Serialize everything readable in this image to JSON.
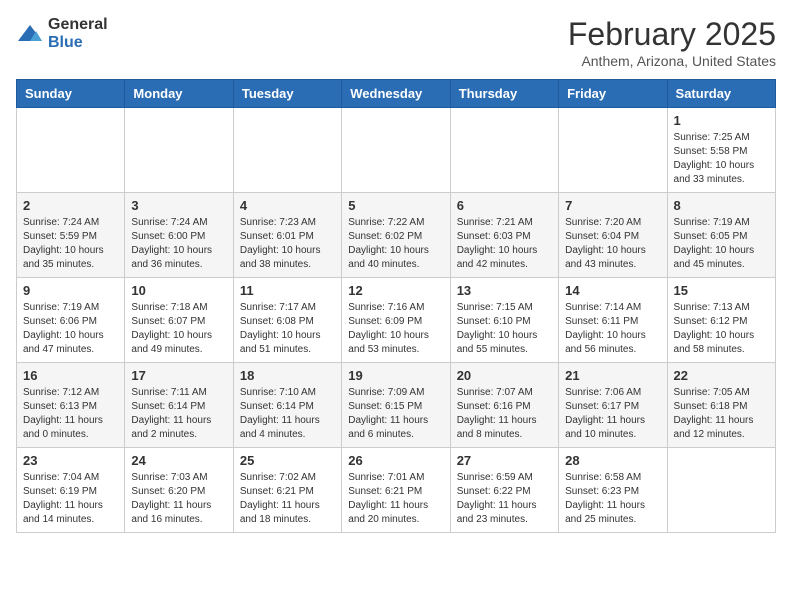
{
  "header": {
    "logo_general": "General",
    "logo_blue": "Blue",
    "month": "February 2025",
    "location": "Anthem, Arizona, United States"
  },
  "weekdays": [
    "Sunday",
    "Monday",
    "Tuesday",
    "Wednesday",
    "Thursday",
    "Friday",
    "Saturday"
  ],
  "weeks": [
    [
      {
        "day": "",
        "info": ""
      },
      {
        "day": "",
        "info": ""
      },
      {
        "day": "",
        "info": ""
      },
      {
        "day": "",
        "info": ""
      },
      {
        "day": "",
        "info": ""
      },
      {
        "day": "",
        "info": ""
      },
      {
        "day": "1",
        "info": "Sunrise: 7:25 AM\nSunset: 5:58 PM\nDaylight: 10 hours\nand 33 minutes."
      }
    ],
    [
      {
        "day": "2",
        "info": "Sunrise: 7:24 AM\nSunset: 5:59 PM\nDaylight: 10 hours\nand 35 minutes."
      },
      {
        "day": "3",
        "info": "Sunrise: 7:24 AM\nSunset: 6:00 PM\nDaylight: 10 hours\nand 36 minutes."
      },
      {
        "day": "4",
        "info": "Sunrise: 7:23 AM\nSunset: 6:01 PM\nDaylight: 10 hours\nand 38 minutes."
      },
      {
        "day": "5",
        "info": "Sunrise: 7:22 AM\nSunset: 6:02 PM\nDaylight: 10 hours\nand 40 minutes."
      },
      {
        "day": "6",
        "info": "Sunrise: 7:21 AM\nSunset: 6:03 PM\nDaylight: 10 hours\nand 42 minutes."
      },
      {
        "day": "7",
        "info": "Sunrise: 7:20 AM\nSunset: 6:04 PM\nDaylight: 10 hours\nand 43 minutes."
      },
      {
        "day": "8",
        "info": "Sunrise: 7:19 AM\nSunset: 6:05 PM\nDaylight: 10 hours\nand 45 minutes."
      }
    ],
    [
      {
        "day": "9",
        "info": "Sunrise: 7:19 AM\nSunset: 6:06 PM\nDaylight: 10 hours\nand 47 minutes."
      },
      {
        "day": "10",
        "info": "Sunrise: 7:18 AM\nSunset: 6:07 PM\nDaylight: 10 hours\nand 49 minutes."
      },
      {
        "day": "11",
        "info": "Sunrise: 7:17 AM\nSunset: 6:08 PM\nDaylight: 10 hours\nand 51 minutes."
      },
      {
        "day": "12",
        "info": "Sunrise: 7:16 AM\nSunset: 6:09 PM\nDaylight: 10 hours\nand 53 minutes."
      },
      {
        "day": "13",
        "info": "Sunrise: 7:15 AM\nSunset: 6:10 PM\nDaylight: 10 hours\nand 55 minutes."
      },
      {
        "day": "14",
        "info": "Sunrise: 7:14 AM\nSunset: 6:11 PM\nDaylight: 10 hours\nand 56 minutes."
      },
      {
        "day": "15",
        "info": "Sunrise: 7:13 AM\nSunset: 6:12 PM\nDaylight: 10 hours\nand 58 minutes."
      }
    ],
    [
      {
        "day": "16",
        "info": "Sunrise: 7:12 AM\nSunset: 6:13 PM\nDaylight: 11 hours\nand 0 minutes."
      },
      {
        "day": "17",
        "info": "Sunrise: 7:11 AM\nSunset: 6:14 PM\nDaylight: 11 hours\nand 2 minutes."
      },
      {
        "day": "18",
        "info": "Sunrise: 7:10 AM\nSunset: 6:14 PM\nDaylight: 11 hours\nand 4 minutes."
      },
      {
        "day": "19",
        "info": "Sunrise: 7:09 AM\nSunset: 6:15 PM\nDaylight: 11 hours\nand 6 minutes."
      },
      {
        "day": "20",
        "info": "Sunrise: 7:07 AM\nSunset: 6:16 PM\nDaylight: 11 hours\nand 8 minutes."
      },
      {
        "day": "21",
        "info": "Sunrise: 7:06 AM\nSunset: 6:17 PM\nDaylight: 11 hours\nand 10 minutes."
      },
      {
        "day": "22",
        "info": "Sunrise: 7:05 AM\nSunset: 6:18 PM\nDaylight: 11 hours\nand 12 minutes."
      }
    ],
    [
      {
        "day": "23",
        "info": "Sunrise: 7:04 AM\nSunset: 6:19 PM\nDaylight: 11 hours\nand 14 minutes."
      },
      {
        "day": "24",
        "info": "Sunrise: 7:03 AM\nSunset: 6:20 PM\nDaylight: 11 hours\nand 16 minutes."
      },
      {
        "day": "25",
        "info": "Sunrise: 7:02 AM\nSunset: 6:21 PM\nDaylight: 11 hours\nand 18 minutes."
      },
      {
        "day": "26",
        "info": "Sunrise: 7:01 AM\nSunset: 6:21 PM\nDaylight: 11 hours\nand 20 minutes."
      },
      {
        "day": "27",
        "info": "Sunrise: 6:59 AM\nSunset: 6:22 PM\nDaylight: 11 hours\nand 23 minutes."
      },
      {
        "day": "28",
        "info": "Sunrise: 6:58 AM\nSunset: 6:23 PM\nDaylight: 11 hours\nand 25 minutes."
      },
      {
        "day": "",
        "info": ""
      }
    ]
  ]
}
